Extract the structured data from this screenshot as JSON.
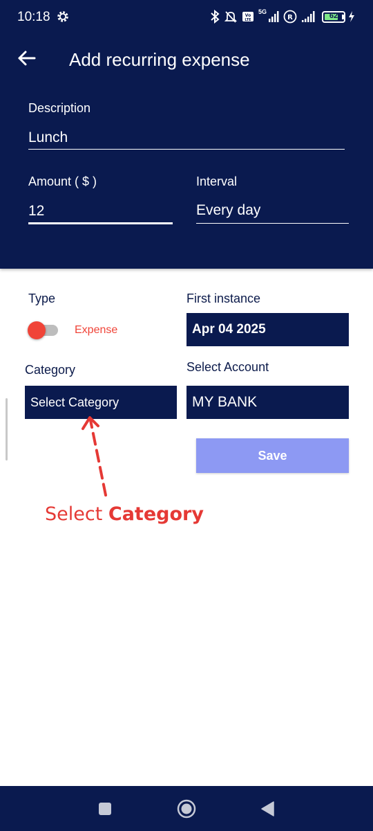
{
  "status_bar": {
    "time": "10:18",
    "network_label": "5G",
    "battery_level": "62",
    "icons": [
      "gear-icon",
      "bluetooth-icon",
      "bell-off-icon",
      "volte-icon",
      "signal-icon",
      "registered-icon",
      "signal-icon",
      "battery-icon",
      "charging-icon"
    ]
  },
  "header": {
    "title": "Add recurring expense",
    "back_icon": "arrow-left-icon"
  },
  "form": {
    "description": {
      "label": "Description",
      "value": "Lunch"
    },
    "amount": {
      "label": "Amount ( $ )",
      "value": "12"
    },
    "interval": {
      "label": "Interval",
      "value": "Every day"
    },
    "type": {
      "label": "Type",
      "toggle_label": "Expense",
      "toggle_on": false
    },
    "first_instance": {
      "label": "First instance",
      "value": "Apr 04 2025"
    },
    "category": {
      "label": "Category",
      "value": "Select Category"
    },
    "account": {
      "label": "Select Account",
      "value": "MY BANK"
    },
    "save_label": "Save"
  },
  "annotation": {
    "text_plain": "Select ",
    "text_bold": "Category",
    "color": "#e53935"
  },
  "nav_bar": {
    "icons": [
      "square-icon",
      "circle-icon",
      "triangle-back-icon"
    ]
  },
  "colors": {
    "primary": "#0a1a4f",
    "accent_red": "#f04438",
    "save_button": "#8d99f3"
  }
}
